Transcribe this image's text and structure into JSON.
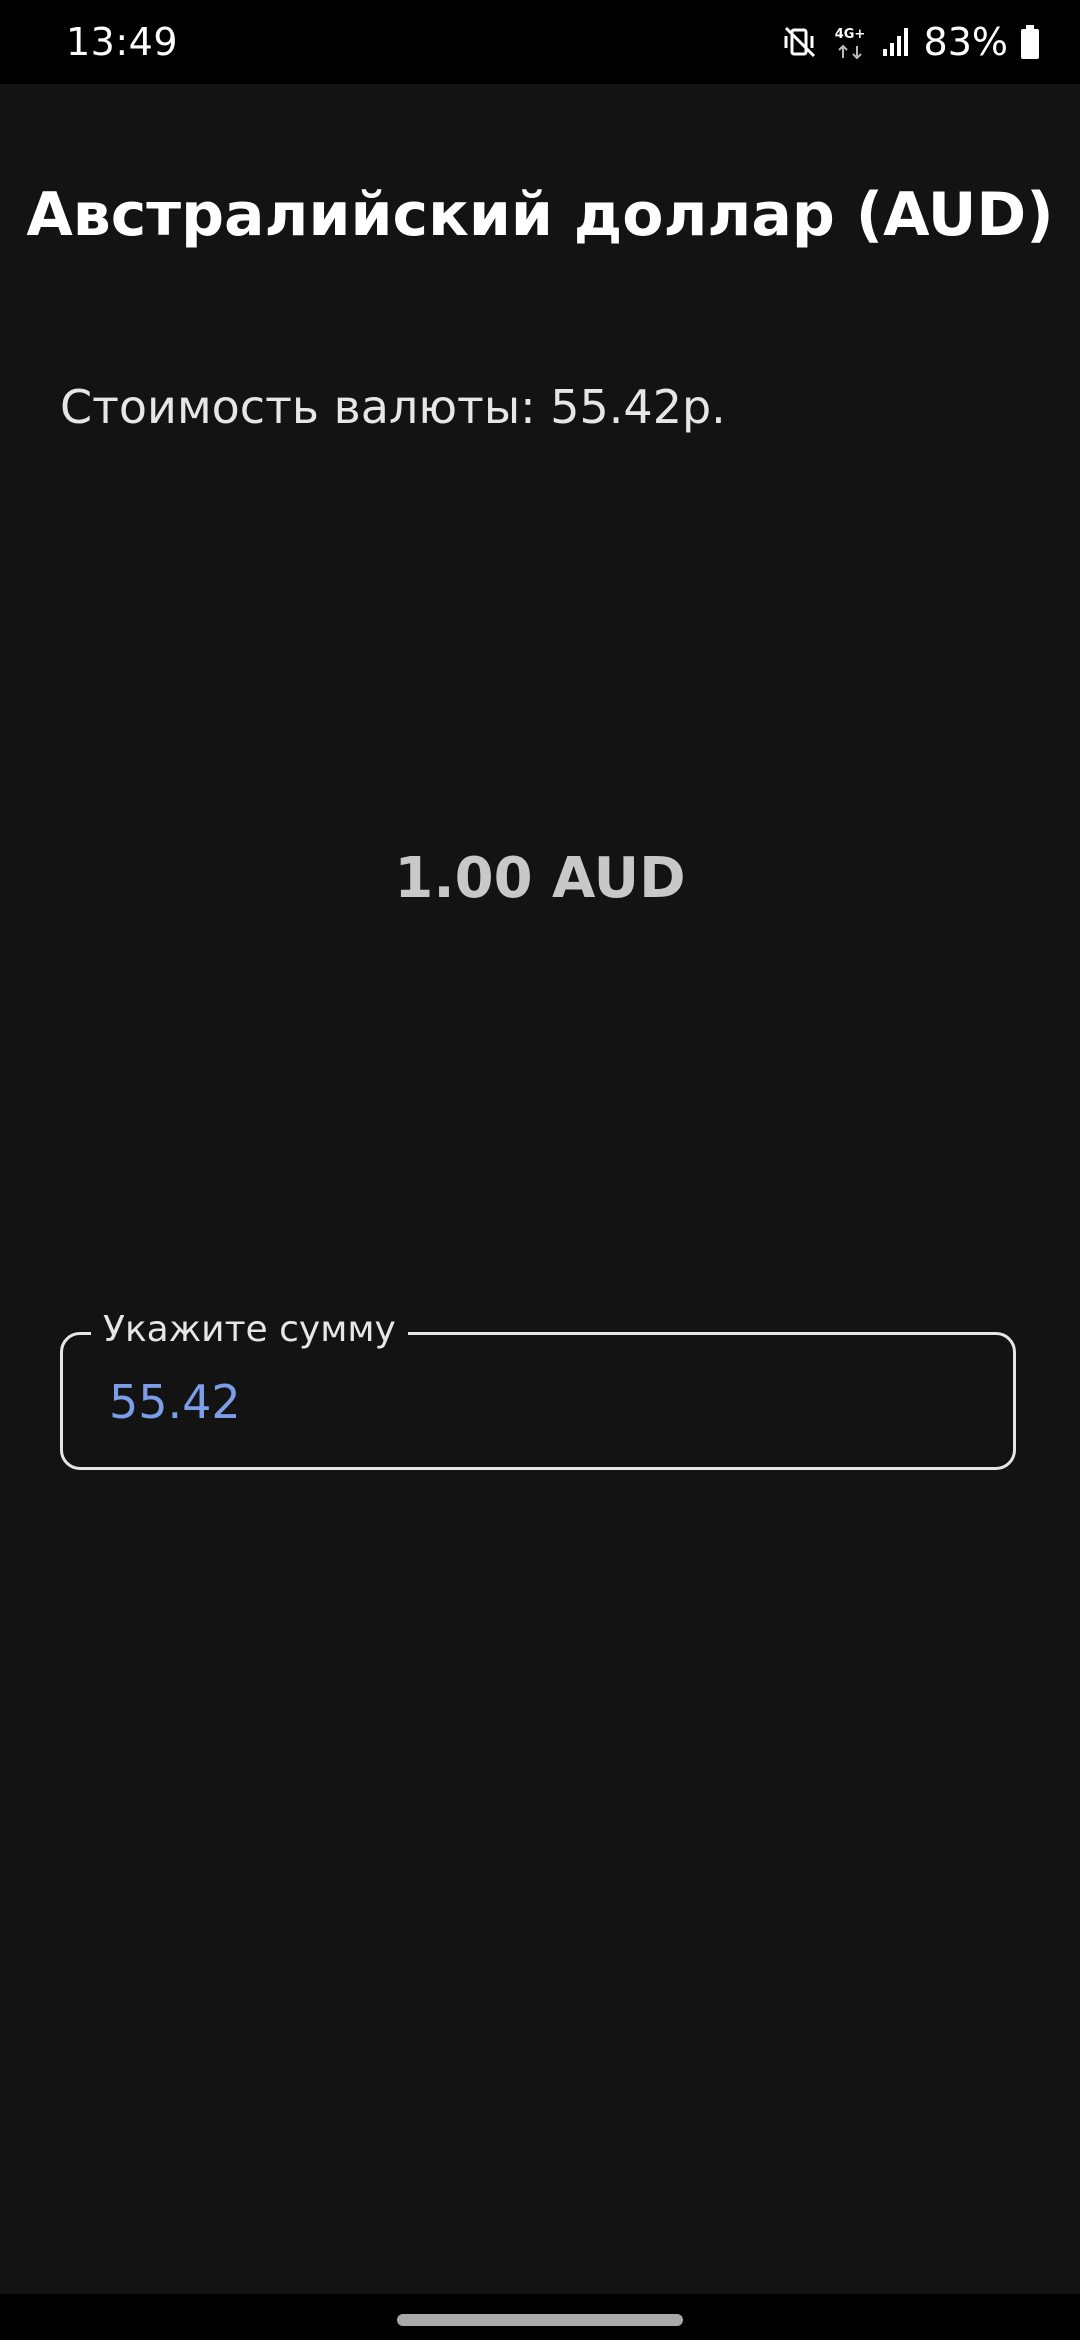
{
  "status_bar": {
    "time": "13:49",
    "network_label": "4G+",
    "battery": "83%",
    "icons": [
      "vibrate-mute-icon",
      "network-4g-icon",
      "signal-icon",
      "battery-icon"
    ]
  },
  "header": {
    "title": "Австралийский доллар (AUD)"
  },
  "main": {
    "price_text": "Стоимость валюты: 55.42р.",
    "converted_amount": "1.00 AUD",
    "amount_input": {
      "label": "Укажите сумму",
      "value": "55.42"
    }
  },
  "colors": {
    "background": "#131313",
    "status_bar": "#000000",
    "input_value": "#7b9ee6",
    "amount_text": "#c8c8c8"
  }
}
